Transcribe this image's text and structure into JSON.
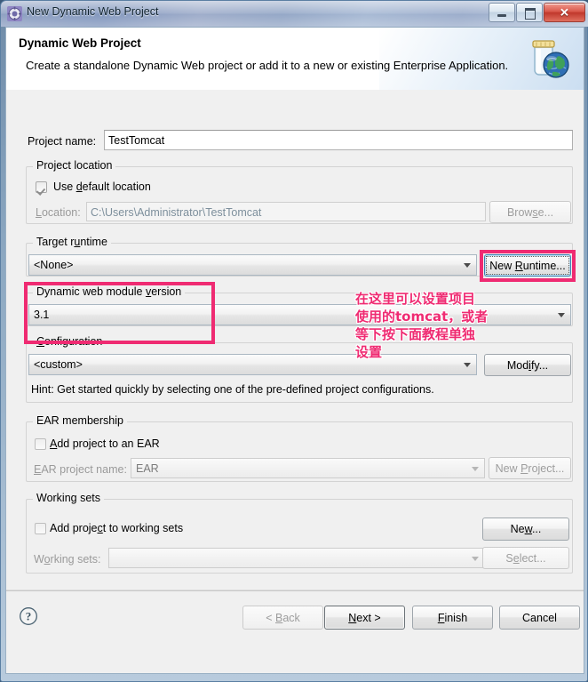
{
  "window": {
    "title": "New Dynamic Web Project",
    "title_icon": "gear-icon",
    "minimize_label": "Minimize",
    "maximize_label": "Maximize",
    "close_label": "✕"
  },
  "header": {
    "title": "Dynamic Web Project",
    "description": "Create a standalone Dynamic Web project or add it to a new or existing Enterprise Application.",
    "icon": "jar-globe-icon"
  },
  "form": {
    "project_name": {
      "label": "Project name:",
      "value": "TestTomcat",
      "placeholder": ""
    },
    "project_location": {
      "group_label": "Project location",
      "use_default_label": "Use default location",
      "use_default_checked": true,
      "location_label": "Location:",
      "location_value": "C:\\Users\\Administrator\\TestTomcat",
      "browse_label": "Browse..."
    },
    "target_runtime": {
      "group_label": "Target runtime",
      "selected": "<None>",
      "new_runtime_label": "New Runtime..."
    },
    "dynamic_web_module_version": {
      "group_label": "Dynamic web module version",
      "selected": "3.1"
    },
    "configuration": {
      "group_label": "Configuration",
      "selected": "<custom>",
      "modify_label": "Modify...",
      "hint": "Hint: Get started quickly by selecting one of the pre-defined project configurations."
    },
    "ear_membership": {
      "group_label": "EAR membership",
      "add_project_label": "Add project to an EAR",
      "add_project_checked": false,
      "ear_project_name_label": "EAR project name:",
      "ear_project_name_value": "EAR",
      "new_project_label": "New Project..."
    },
    "working_sets": {
      "group_label": "Working sets",
      "add_project_label": "Add project to working sets",
      "add_project_checked": false,
      "working_sets_label": "Working sets:",
      "working_sets_value": "",
      "new_label": "New...",
      "select_label": "Select..."
    }
  },
  "footer": {
    "help_icon": "question-mark-icon",
    "back_label": "< Back",
    "back_disabled": true,
    "next_label": "Next >",
    "next_default": true,
    "finish_label": "Finish",
    "cancel_label": "Cancel"
  },
  "annotations": {
    "accent_color": "#ef2b72",
    "note_text": "在这里可以设置项目\n使用的tomcat，或者\n等下按下面教程单独\n设置",
    "highlight_new_runtime": "New Runtime... button highlighted",
    "highlight_module_version": "Dynamic web module version highlighted"
  }
}
